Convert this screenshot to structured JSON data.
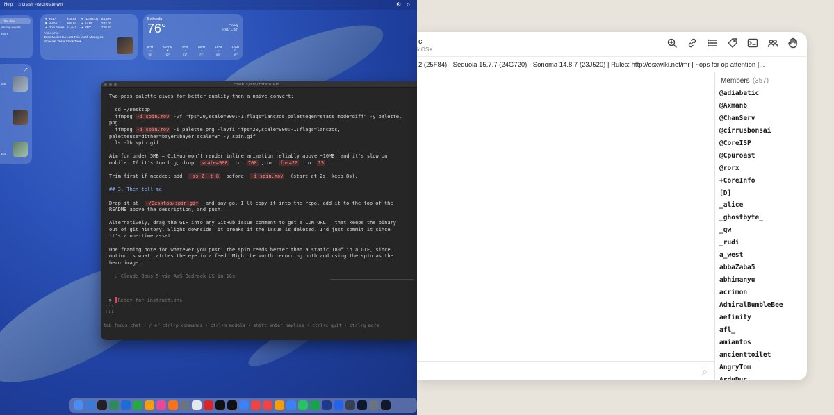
{
  "desktop": {
    "menubar": {
      "items": [
        "Help",
        "⌂ cnash ~/src/rotate-win"
      ]
    },
    "calendar_widget": {
      "rows": [
        "",
        "the deal",
        "",
        "all-day events",
        "",
        "more"
      ]
    },
    "stocks_widget": {
      "rows": [
        [
          "▼ TSLA",
          "313.03",
          "▼ NASDAQ",
          "24,976"
        ],
        [
          "▼ NVDA",
          "206.84",
          "▲ AAPL",
          "333.02"
        ],
        [
          "▲ Dow Jones",
          "51,647",
          "▲ SPY",
          "728.93"
        ]
      ],
      "news_source": "Yahoo Fin",
      "news_headline": "Elon Musk Has Lost This Much Money as SpaceX, Tesla Stock Tank"
    },
    "weather_widget": {
      "city": "Bethesda",
      "temp": "76°",
      "condition": "Cloudy",
      "hilo": "H:81° L:60°",
      "hours": [
        {
          "time": "8PM",
          "temp": "76°"
        },
        {
          "time": "8:27PM",
          "temp": "72°"
        },
        {
          "time": "9PM",
          "temp": "72°"
        },
        {
          "time": "10PM",
          "temp": "71°"
        },
        {
          "time": "11PM",
          "temp": "69°"
        },
        {
          "time": "12AM",
          "temp": "69°"
        }
      ]
    },
    "side_widget": {
      "labels": [
        "ord",
        "",
        "tail..."
      ]
    },
    "terminal": {
      "title": "cnash ~/src/rotate-win",
      "lines": [
        "Two-pass palette gives for better quality than a naive convert:",
        "",
        "  cd ~/Desktop",
        "  ffmpeg -i spin.mov -vf \"fps=20,scale=900:-1:flags=lanczos,palettegen=stats_mode=diff\" -y palette.",
        "png",
        "  ffmpeg -i spin.mov -i palette.png -lavfi \"fps=20,scale=900:-1:flags=lanczos,",
        "paletteuse=dither=bayer:bayer_scale=3\" -y spin.gif",
        "  ls -lh spin.gif",
        "",
        "Aim for under 5MB — GitHub won't render inline animation reliably above ~10MB, and it's slow on",
        "mobile. If it's too big, drop  scale=900  to  700 , or  fps=20  to  15 .",
        "",
        "Trim first if needed: add  -ss 2 -t 8  before  -i spin.mov  (start at 2s, keep 8s).",
        "",
        "## 3. Then tell me",
        "",
        "Drop it at  ~/Desktop/spin.gif  and say go. I'll copy it into the repo, add it to the top of the",
        "README above the description, and push.",
        "",
        "Alternatively, drag the GIF into any GitHub issue comment to get a CDN URL — that keeps the binary",
        "out of git history. Slight downside: it breaks if the issue is deleted. I'd just commit it since",
        "it's a one-time asset.",
        "",
        "One framing note for whatever you post: the spin reads better than a static 180° in a GIF, since",
        "motion is what catches the eye in a feed. Might be worth recording both and using the spin as the",
        "hero image.",
        "",
        "  ▫ Claude Opus 5 via AWS Bedrock US in 16s"
      ],
      "prompt_symbol": ">",
      "prompt_placeholder": "Ready for instructions",
      "colons": ":::\n:::",
      "status": "tab focus chat • / or ctrl+p commands • ctrl+m models • shift+enter newline • ctrl+c quit • ctrl+g more"
    },
    "dock_colors": [
      "#4a8df5",
      "#3a7bd5",
      "#222",
      "#2f8c5a",
      "#1e6cd6",
      "#27a745",
      "#f59e0b",
      "#ec4899",
      "#f97316",
      "#6b7280",
      "#e5e7eb",
      "#dc2626",
      "#111",
      "#111",
      "#3b82f6",
      "#ef4444",
      "#ef4444",
      "#f59e0b",
      "#3b82f6",
      "#22c55e",
      "#16a34a",
      "#1e3a8a",
      "#2563eb",
      "#374151",
      "#0f172a",
      "#6b7280",
      "#111827"
    ]
  },
  "irc": {
    "channel_name": "c",
    "channel_subtitle": "icOSX",
    "topic": "2 (25F84) - Sequoia 15.7.7 (24G720) - Sonoma 14.8.7 (23J520) | Rules: http://osxwiki.net/mr | ~ops for op attention |...",
    "members_label": "Members",
    "members_count": "(357)",
    "members": [
      "@adiabatic",
      "@Axman6",
      "@ChanServ",
      "@cirrusbonsai",
      "@CoreISP",
      "@Cpuroast",
      "@rorx",
      "+CoreInfo",
      "[D]",
      "_alice",
      "_ghostbyte_",
      "_qw",
      "_rudi",
      "a_west",
      "abbaZaba5",
      "abhimanyu",
      "acrimon",
      "AdmiralBumbleBee",
      "aefinity",
      "afl_",
      "amiantos",
      "ancienttoilet",
      "AngryTom",
      "ArduDuc"
    ],
    "toolbar": [
      "search-icon",
      "link-icon",
      "list-icon",
      "tag-icon",
      "terminal-icon",
      "members-icon",
      "hand-icon"
    ]
  }
}
